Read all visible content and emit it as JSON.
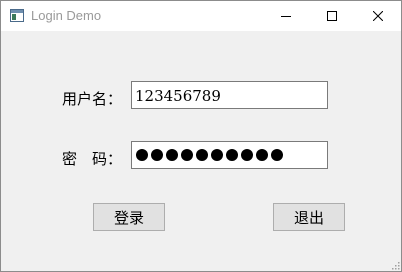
{
  "window": {
    "title": "Login Demo",
    "icon": "app-window-icon",
    "controls": [
      "minimize-icon",
      "maximize-icon",
      "close-icon"
    ]
  },
  "form": {
    "username": {
      "label": "用户名：",
      "value": "123456789"
    },
    "password": {
      "label_part1": "密",
      "label_part2": "码：",
      "masked_length": 10
    }
  },
  "buttons": {
    "login_label": "登录",
    "quit_label": "退出"
  },
  "colors": {
    "background": "#f0f0f0",
    "titlebar": "#ffffff",
    "title_text": "#9a9a9a",
    "button_face": "#e1e1e1",
    "field_border": "#7a7a7a"
  }
}
